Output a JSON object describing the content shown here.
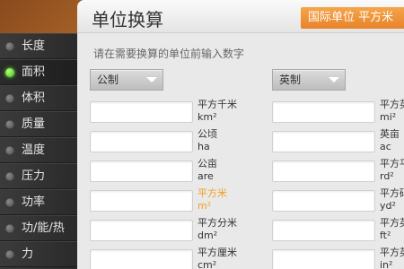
{
  "header": {
    "title": "单位换算",
    "tab_label": "国际单位  平方米"
  },
  "sidebar": {
    "items": [
      {
        "label": "长度",
        "active": false
      },
      {
        "label": "面积",
        "active": true
      },
      {
        "label": "体积",
        "active": false
      },
      {
        "label": "质量",
        "active": false
      },
      {
        "label": "温度",
        "active": false
      },
      {
        "label": "压力",
        "active": false
      },
      {
        "label": "功率",
        "active": false
      },
      {
        "label": "功/能/热",
        "active": false
      },
      {
        "label": "力",
        "active": false
      }
    ]
  },
  "main": {
    "hint": "请在需要换算的单位前输入数字",
    "left_system": "公制",
    "right_system": "英制",
    "left_units": [
      {
        "name": "平方千米",
        "symbol": "km²"
      },
      {
        "name": "公顷",
        "symbol": "ha"
      },
      {
        "name": "公亩",
        "symbol": "are"
      },
      {
        "name": "平方米",
        "symbol": "m²",
        "highlight": true
      },
      {
        "name": "平方分米",
        "symbol": "dm²"
      },
      {
        "name": "平方厘米",
        "symbol": "cm²"
      }
    ],
    "right_units": [
      {
        "name": "平方英",
        "symbol": "mi²"
      },
      {
        "name": "英亩",
        "symbol": "ac"
      },
      {
        "name": "平方平",
        "symbol": "rd²"
      },
      {
        "name": "平方码",
        "symbol": "yd²"
      },
      {
        "name": "平方英",
        "symbol": "ft²"
      },
      {
        "name": "平方英",
        "symbol": "in²"
      }
    ]
  },
  "colors": {
    "accent": "#f0a020",
    "tab": "#e8832a",
    "active_dot": "#3fbf1a"
  }
}
